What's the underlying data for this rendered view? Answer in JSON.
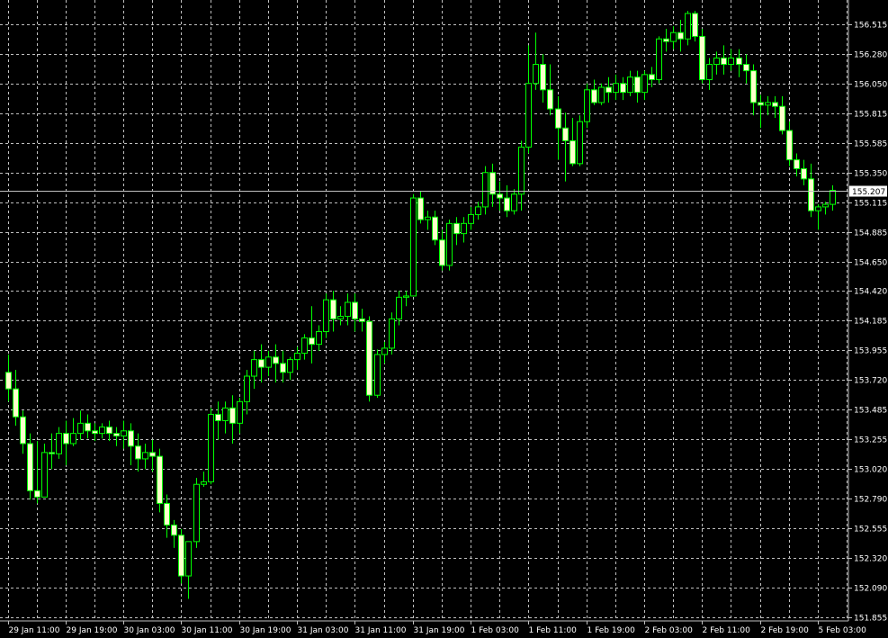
{
  "colors": {
    "background": "#000000",
    "grid": "#c0c0c0",
    "axis_text": "#ffffff",
    "wick": "#00ff00",
    "bull_body": "#000000",
    "bear_body": "#ffffcc",
    "current_price_line": "#c0c0c0",
    "current_price_box": "#ffffff",
    "current_price_text": "#000000"
  },
  "chart_data": {
    "type": "candlestick",
    "title": "",
    "xlabel": "",
    "ylabel": "",
    "ylim": [
      151.855,
      156.632
    ],
    "grid": true,
    "y_ticks": [
      "156.515",
      "156.280",
      "156.050",
      "155.815",
      "155.585",
      "155.350",
      "155.115",
      "154.885",
      "154.650",
      "154.420",
      "154.185",
      "153.955",
      "153.720",
      "153.485",
      "153.255",
      "153.020",
      "152.790",
      "152.555",
      "152.320",
      "152.090",
      "151.855"
    ],
    "x_ticks": [
      {
        "label": "29 Jan 11:00",
        "bar": 0
      },
      {
        "label": "29 Jan 19:00",
        "bar": 8
      },
      {
        "label": "30 Jan 03:00",
        "bar": 16
      },
      {
        "label": "30 Jan 11:00",
        "bar": 24
      },
      {
        "label": "30 Jan 19:00",
        "bar": 32
      },
      {
        "label": "31 Jan 03:00",
        "bar": 40
      },
      {
        "label": "31 Jan 11:00",
        "bar": 48
      },
      {
        "label": "31 Jan 19:00",
        "bar": 56
      },
      {
        "label": "1 Feb 03:00",
        "bar": 64
      },
      {
        "label": "1 Feb 11:00",
        "bar": 72
      },
      {
        "label": "1 Feb 19:00",
        "bar": 80
      },
      {
        "label": "2 Feb 03:00",
        "bar": 88
      },
      {
        "label": "2 Feb 11:00",
        "bar": 96
      },
      {
        "label": "2 Feb 19:00",
        "bar": 104
      },
      {
        "label": "5 Feb 03:00",
        "bar": 112
      }
    ],
    "current_price": "155.207",
    "candles": [
      {
        "o": 153.78,
        "h": 153.92,
        "c": 153.65,
        "l": 153.55
      },
      {
        "o": 153.65,
        "h": 153.8,
        "c": 153.43,
        "l": 153.36
      },
      {
        "o": 153.43,
        "h": 153.48,
        "c": 153.22,
        "l": 153.14
      },
      {
        "o": 153.22,
        "h": 153.3,
        "c": 152.85,
        "l": 152.78
      },
      {
        "o": 152.85,
        "h": 153.24,
        "c": 152.8,
        "l": 152.75
      },
      {
        "o": 152.8,
        "h": 153.22,
        "c": 153.15,
        "l": 152.8
      },
      {
        "o": 153.15,
        "h": 153.3,
        "c": 153.14,
        "l": 153.02
      },
      {
        "o": 153.14,
        "h": 153.35,
        "c": 153.3,
        "l": 153.1
      },
      {
        "o": 153.3,
        "h": 153.4,
        "c": 153.22,
        "l": 153.05
      },
      {
        "o": 153.22,
        "h": 153.42,
        "c": 153.3,
        "l": 153.2
      },
      {
        "o": 153.3,
        "h": 153.48,
        "c": 153.38,
        "l": 153.25
      },
      {
        "o": 153.38,
        "h": 153.45,
        "c": 153.32,
        "l": 153.26
      },
      {
        "o": 153.32,
        "h": 153.38,
        "c": 153.3,
        "l": 153.24
      },
      {
        "o": 153.3,
        "h": 153.38,
        "c": 153.35,
        "l": 153.26
      },
      {
        "o": 153.35,
        "h": 153.4,
        "c": 153.3,
        "l": 153.24
      },
      {
        "o": 153.3,
        "h": 153.35,
        "c": 153.28,
        "l": 153.2
      },
      {
        "o": 153.28,
        "h": 153.4,
        "c": 153.32,
        "l": 153.18
      },
      {
        "o": 153.32,
        "h": 153.38,
        "c": 153.2,
        "l": 153.05
      },
      {
        "o": 153.2,
        "h": 153.3,
        "c": 153.1,
        "l": 153.0
      },
      {
        "o": 153.1,
        "h": 153.22,
        "c": 153.15,
        "l": 153.02
      },
      {
        "o": 153.15,
        "h": 153.25,
        "c": 153.12,
        "l": 153.0
      },
      {
        "o": 153.12,
        "h": 153.18,
        "c": 152.75,
        "l": 152.68
      },
      {
        "o": 152.75,
        "h": 152.82,
        "c": 152.58,
        "l": 152.48
      },
      {
        "o": 152.58,
        "h": 152.62,
        "c": 152.5,
        "l": 152.4
      },
      {
        "o": 152.5,
        "h": 152.55,
        "c": 152.18,
        "l": 152.12
      },
      {
        "o": 152.18,
        "h": 152.45,
        "c": 152.45,
        "l": 152.0
      },
      {
        "o": 152.45,
        "h": 152.95,
        "c": 152.9,
        "l": 152.4
      },
      {
        "o": 152.9,
        "h": 153.0,
        "c": 152.92,
        "l": 152.88
      },
      {
        "o": 152.92,
        "h": 153.5,
        "c": 153.45,
        "l": 152.9
      },
      {
        "o": 153.45,
        "h": 153.55,
        "c": 153.4,
        "l": 153.25
      },
      {
        "o": 153.4,
        "h": 153.55,
        "c": 153.5,
        "l": 153.3
      },
      {
        "o": 153.5,
        "h": 153.6,
        "c": 153.38,
        "l": 153.22
      },
      {
        "o": 153.38,
        "h": 153.58,
        "c": 153.55,
        "l": 153.3
      },
      {
        "o": 153.55,
        "h": 153.8,
        "c": 153.75,
        "l": 153.45
      },
      {
        "o": 153.75,
        "h": 153.95,
        "c": 153.88,
        "l": 153.65
      },
      {
        "o": 153.88,
        "h": 154.0,
        "c": 153.82,
        "l": 153.7
      },
      {
        "o": 153.82,
        "h": 153.95,
        "c": 153.9,
        "l": 153.75
      },
      {
        "o": 153.9,
        "h": 154.0,
        "c": 153.85,
        "l": 153.7
      },
      {
        "o": 153.85,
        "h": 153.95,
        "c": 153.78,
        "l": 153.7
      },
      {
        "o": 153.78,
        "h": 153.9,
        "c": 153.88,
        "l": 153.72
      },
      {
        "o": 153.88,
        "h": 153.98,
        "c": 153.93,
        "l": 153.8
      },
      {
        "o": 153.93,
        "h": 154.08,
        "c": 154.05,
        "l": 153.88
      },
      {
        "o": 154.05,
        "h": 154.3,
        "c": 154.0,
        "l": 153.85
      },
      {
        "o": 154.0,
        "h": 154.15,
        "c": 154.1,
        "l": 153.95
      },
      {
        "o": 154.1,
        "h": 154.4,
        "c": 154.35,
        "l": 154.05
      },
      {
        "o": 154.35,
        "h": 154.42,
        "c": 154.2,
        "l": 154.1
      },
      {
        "o": 154.2,
        "h": 154.3,
        "c": 154.22,
        "l": 154.15
      },
      {
        "o": 154.22,
        "h": 154.4,
        "c": 154.33,
        "l": 154.15
      },
      {
        "o": 154.33,
        "h": 154.4,
        "c": 154.2,
        "l": 154.1
      },
      {
        "o": 154.2,
        "h": 154.28,
        "c": 154.18,
        "l": 154.1
      },
      {
        "o": 154.18,
        "h": 154.22,
        "c": 153.6,
        "l": 153.55
      },
      {
        "o": 153.6,
        "h": 153.96,
        "c": 153.92,
        "l": 153.58
      },
      {
        "o": 153.92,
        "h": 154.02,
        "c": 153.97,
        "l": 153.85
      },
      {
        "o": 153.97,
        "h": 154.25,
        "c": 154.2,
        "l": 153.92
      },
      {
        "o": 154.2,
        "h": 154.42,
        "c": 154.37,
        "l": 154.15
      },
      {
        "o": 154.37,
        "h": 154.42,
        "c": 154.38,
        "l": 154.3
      },
      {
        "o": 154.38,
        "h": 155.18,
        "c": 155.15,
        "l": 154.38
      },
      {
        "o": 155.15,
        "h": 155.2,
        "c": 154.98,
        "l": 154.95
      },
      {
        "o": 154.98,
        "h": 155.05,
        "c": 155.0,
        "l": 154.9
      },
      {
        "o": 155.0,
        "h": 155.05,
        "c": 154.82,
        "l": 154.78
      },
      {
        "o": 154.82,
        "h": 154.9,
        "c": 154.62,
        "l": 154.58
      },
      {
        "o": 154.62,
        "h": 154.98,
        "c": 154.95,
        "l": 154.58
      },
      {
        "o": 154.95,
        "h": 155.0,
        "c": 154.87,
        "l": 154.78
      },
      {
        "o": 154.87,
        "h": 155.0,
        "c": 154.95,
        "l": 154.8
      },
      {
        "o": 154.95,
        "h": 155.08,
        "c": 155.02,
        "l": 154.9
      },
      {
        "o": 155.02,
        "h": 155.12,
        "c": 155.08,
        "l": 154.98
      },
      {
        "o": 155.08,
        "h": 155.4,
        "c": 155.35,
        "l": 155.02
      },
      {
        "o": 155.35,
        "h": 155.42,
        "c": 155.18,
        "l": 155.08
      },
      {
        "o": 155.18,
        "h": 155.28,
        "c": 155.15,
        "l": 155.05
      },
      {
        "o": 155.15,
        "h": 155.25,
        "c": 155.05,
        "l": 155.0
      },
      {
        "o": 155.05,
        "h": 155.22,
        "c": 155.18,
        "l": 155.02
      },
      {
        "o": 155.18,
        "h": 155.6,
        "c": 155.55,
        "l": 155.05
      },
      {
        "o": 155.55,
        "h": 156.35,
        "c": 156.05,
        "l": 155.5
      },
      {
        "o": 156.05,
        "h": 156.45,
        "c": 156.2,
        "l": 156.0
      },
      {
        "o": 156.2,
        "h": 156.28,
        "c": 156.0,
        "l": 155.9
      },
      {
        "o": 156.0,
        "h": 156.2,
        "c": 155.85,
        "l": 155.8
      },
      {
        "o": 155.85,
        "h": 155.95,
        "c": 155.7,
        "l": 155.45
      },
      {
        "o": 155.7,
        "h": 155.82,
        "c": 155.6,
        "l": 155.28
      },
      {
        "o": 155.6,
        "h": 155.78,
        "c": 155.42,
        "l": 155.4
      },
      {
        "o": 155.42,
        "h": 155.8,
        "c": 155.75,
        "l": 155.4
      },
      {
        "o": 155.75,
        "h": 156.05,
        "c": 156.0,
        "l": 155.7
      },
      {
        "o": 156.0,
        "h": 156.08,
        "c": 155.9,
        "l": 155.88
      },
      {
        "o": 155.9,
        "h": 156.05,
        "c": 156.02,
        "l": 155.88
      },
      {
        "o": 156.02,
        "h": 156.1,
        "c": 155.98,
        "l": 155.9
      },
      {
        "o": 155.98,
        "h": 156.12,
        "c": 156.05,
        "l": 155.92
      },
      {
        "o": 156.05,
        "h": 156.1,
        "c": 155.98,
        "l": 155.92
      },
      {
        "o": 155.98,
        "h": 156.15,
        "c": 156.1,
        "l": 155.95
      },
      {
        "o": 156.1,
        "h": 156.15,
        "c": 155.98,
        "l": 155.9
      },
      {
        "o": 155.98,
        "h": 156.15,
        "c": 156.12,
        "l": 155.92
      },
      {
        "o": 156.12,
        "h": 156.18,
        "c": 156.08,
        "l": 156.02
      },
      {
        "o": 156.08,
        "h": 156.42,
        "c": 156.4,
        "l": 156.05
      },
      {
        "o": 156.4,
        "h": 156.48,
        "c": 156.38,
        "l": 156.3
      },
      {
        "o": 156.38,
        "h": 156.5,
        "c": 156.45,
        "l": 156.32
      },
      {
        "o": 156.45,
        "h": 156.55,
        "c": 156.4,
        "l": 156.3
      },
      {
        "o": 156.4,
        "h": 156.62,
        "c": 156.6,
        "l": 156.35
      },
      {
        "o": 156.6,
        "h": 156.62,
        "c": 156.42,
        "l": 156.38
      },
      {
        "o": 156.42,
        "h": 156.48,
        "c": 156.08,
        "l": 156.05
      },
      {
        "o": 156.08,
        "h": 156.25,
        "c": 156.2,
        "l": 156.0
      },
      {
        "o": 156.2,
        "h": 156.3,
        "c": 156.25,
        "l": 156.12
      },
      {
        "o": 156.25,
        "h": 156.35,
        "c": 156.2,
        "l": 156.12
      },
      {
        "o": 156.2,
        "h": 156.32,
        "c": 156.25,
        "l": 156.15
      },
      {
        "o": 156.25,
        "h": 156.32,
        "c": 156.2,
        "l": 156.1
      },
      {
        "o": 156.2,
        "h": 156.28,
        "c": 156.15,
        "l": 156.05
      },
      {
        "o": 156.15,
        "h": 156.2,
        "c": 155.9,
        "l": 155.8
      },
      {
        "o": 155.9,
        "h": 155.96,
        "c": 155.88,
        "l": 155.7
      },
      {
        "o": 155.88,
        "h": 155.95,
        "c": 155.9,
        "l": 155.8
      },
      {
        "o": 155.9,
        "h": 155.95,
        "c": 155.87,
        "l": 155.78
      },
      {
        "o": 155.87,
        "h": 155.95,
        "c": 155.68,
        "l": 155.65
      },
      {
        "o": 155.68,
        "h": 155.75,
        "c": 155.45,
        "l": 155.4
      },
      {
        "o": 155.45,
        "h": 155.5,
        "c": 155.38,
        "l": 155.32
      },
      {
        "o": 155.38,
        "h": 155.45,
        "c": 155.3,
        "l": 155.25
      },
      {
        "o": 155.3,
        "h": 155.42,
        "c": 155.05,
        "l": 155.0
      },
      {
        "o": 155.05,
        "h": 155.1,
        "c": 155.08,
        "l": 154.9
      },
      {
        "o": 155.08,
        "h": 155.12,
        "c": 155.1,
        "l": 155.02
      },
      {
        "o": 155.1,
        "h": 155.25,
        "c": 155.21,
        "l": 155.05
      }
    ]
  }
}
